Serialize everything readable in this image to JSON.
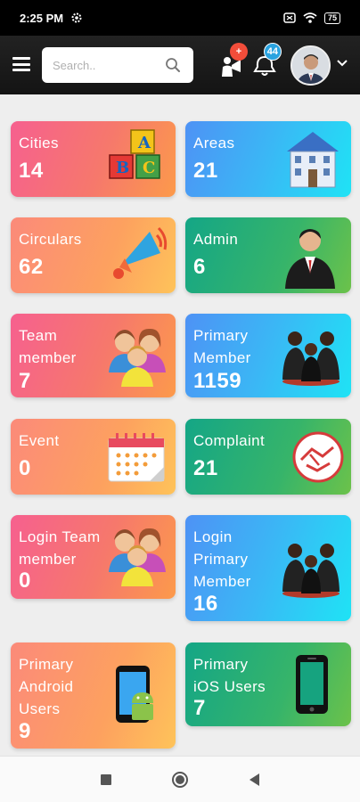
{
  "status_bar": {
    "time": "2:25 PM",
    "battery": "75"
  },
  "header": {
    "search_placeholder": "Search..",
    "announcement_badge": "+",
    "notification_badge": "44"
  },
  "colors": {
    "badge_red": "#f24d3a",
    "badge_blue": "#2aa3e0",
    "header_bg": "#1a1a1a"
  },
  "cards": [
    {
      "label": "Cities",
      "value": "14",
      "icon": "abc-blocks-icon"
    },
    {
      "label": "Areas",
      "value": "21",
      "icon": "building-icon"
    },
    {
      "label": "Circulars",
      "value": "62",
      "icon": "megaphone-icon"
    },
    {
      "label": "Admin",
      "value": "6",
      "icon": "businessman-icon"
    },
    {
      "label": "Team\nmember",
      "value": "7",
      "icon": "team-group-icon"
    },
    {
      "label": "Primary\nMember",
      "value": "1159",
      "icon": "members-meeting-icon"
    },
    {
      "label": "Event",
      "value": "0",
      "icon": "calendar-icon"
    },
    {
      "label": "Complaint",
      "value": "21",
      "icon": "handshake-icon"
    },
    {
      "label": "Login Team\nmember",
      "value": "0",
      "icon": "team-group-icon"
    },
    {
      "label": "Login\nPrimary\nMember",
      "value": "16",
      "icon": "members-meeting-icon"
    },
    {
      "label": "Primary\nAndroid\nUsers",
      "value": "9",
      "icon": "android-phone-icon"
    },
    {
      "label": "Primary\niOS Users",
      "value": "7",
      "icon": "iphone-icon"
    }
  ],
  "nav": {
    "recents": "square-icon",
    "home": "circle-icon",
    "back": "triangle-back-icon"
  }
}
